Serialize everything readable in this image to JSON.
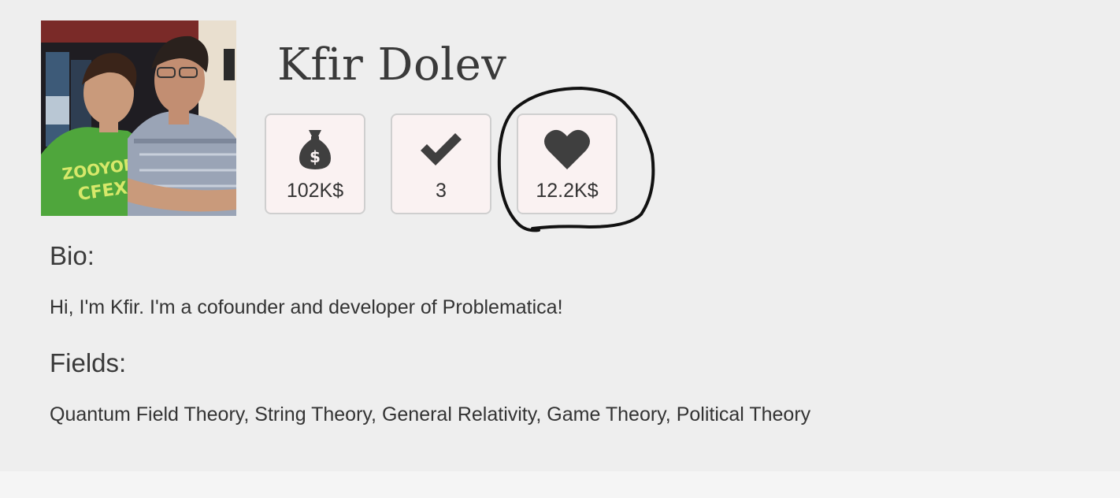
{
  "profile": {
    "name": "Kfir Dolev",
    "avatar_icon": "profile-photo"
  },
  "stats": {
    "money": {
      "icon": "money-bag-icon",
      "value": "102K$"
    },
    "solved": {
      "icon": "checkmark-icon",
      "value": "3"
    },
    "likes": {
      "icon": "heart-icon",
      "value": "12.2K$"
    }
  },
  "bio": {
    "title": "Bio:",
    "text": "Hi, I'm Kfir. I'm a cofounder and developer of Problematica!"
  },
  "fields": {
    "title": "Fields:",
    "text": "Quantum Field Theory, String Theory, General Relativity, Game Theory, Political Theory"
  },
  "colors": {
    "panel_bg": "#eeeeee",
    "page_bg": "#f5f5f5",
    "stat_bg": "#faf2f2",
    "stat_border": "#cfcfcf",
    "icon": "#3f3f3f",
    "annotation": "#111111"
  }
}
